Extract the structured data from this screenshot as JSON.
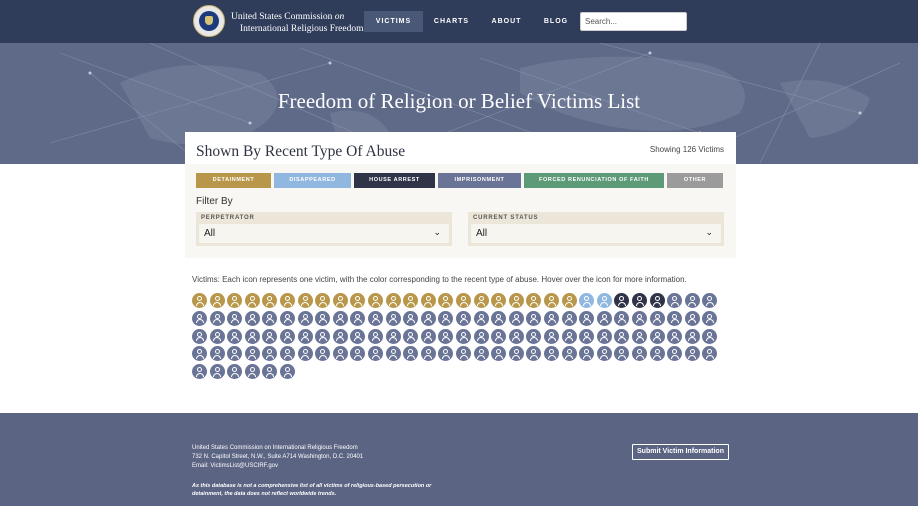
{
  "nav": {
    "org_line1": "United States Commission",
    "org_line1_suffix": "on",
    "org_line2": "International Religious Freedom",
    "links": [
      {
        "label": "VICTIMS",
        "active": true
      },
      {
        "label": "CHARTS",
        "active": false
      },
      {
        "label": "ABOUT",
        "active": false
      },
      {
        "label": "BLOG",
        "active": false
      }
    ],
    "search_placeholder": "Search..."
  },
  "hero": {
    "title": "Freedom of Religion or Belief Victims List"
  },
  "card": {
    "title": "Shown By Recent Type Of Abuse",
    "showing": "Showing 126 Victims",
    "abuse_types": [
      {
        "label": "DETAINMENT",
        "color": "#b8974a"
      },
      {
        "label": "DISAPPEARED",
        "color": "#8fb7e0"
      },
      {
        "label": "HOUSE ARREST",
        "color": "#2f3448"
      },
      {
        "label": "IMPRISONMENT",
        "color": "#6a7496"
      },
      {
        "label": "FORCED RENUNCIATION OF FAITH",
        "color": "#5d9a78"
      },
      {
        "label": "OTHER",
        "color": "#9b9b9b"
      }
    ],
    "filter_label": "Filter By",
    "filters": [
      {
        "caption": "PERPETRATOR",
        "value": "All"
      },
      {
        "caption": "CURRENT STATUS",
        "value": "All"
      }
    ]
  },
  "victims": {
    "caption": "Victims: Each icon represents one victim, with the color corresponding to the recent type of abuse. Hover over the icon for more information.",
    "counts": {
      "detainment": 22,
      "disappeared": 2,
      "house_arrest": 3,
      "imprisonment": 99
    },
    "colors": {
      "detainment": "#b8974a",
      "disappeared": "#8fb7e0",
      "house_arrest": "#2f3448",
      "imprisonment": "#6a7496"
    },
    "order": [
      "detainment",
      "disappeared",
      "house_arrest",
      "imprisonment"
    ]
  },
  "footer": {
    "address_lines": [
      "United States Commission on International Religious Freedom",
      "732 N. Capitol Street, N.W., Suite A714 Washington, D.C. 20401",
      "Email: VictimsList@USCIRF.gov"
    ],
    "disclaimer_lines": [
      "As this database is not a comprehensive list of all victims of religious-based persecution or",
      "detainment, the data does not reflect worldwide trends."
    ],
    "submit_label": "Submit Victim Information"
  }
}
